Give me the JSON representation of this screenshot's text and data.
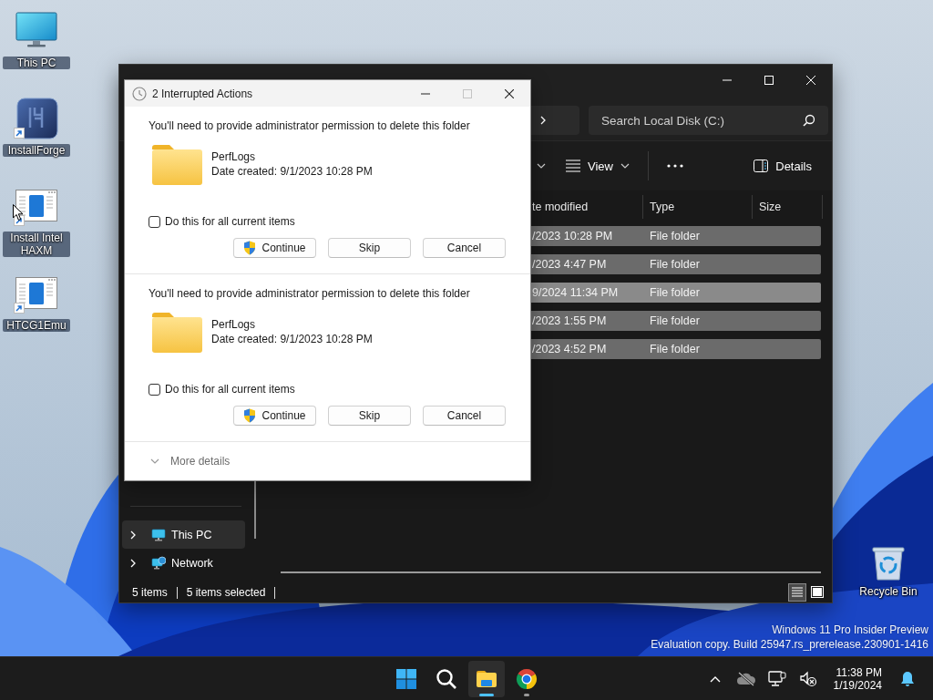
{
  "desktop_icons": [
    {
      "label": "This PC",
      "kind": "computer",
      "shortcut": false
    },
    {
      "label": "InstallForge",
      "kind": "installer",
      "shortcut": true
    },
    {
      "label": "Install Intel HAXM",
      "kind": "app-window",
      "shortcut": true
    },
    {
      "label": "HTCG1Emu",
      "kind": "app-window",
      "shortcut": true
    }
  ],
  "recycle_bin": {
    "label": "Recycle Bin"
  },
  "explorer": {
    "search": {
      "placeholder": "Search Local Disk (C:)"
    },
    "toolbar": {
      "view": "View",
      "details": "Details"
    },
    "columns": [
      "te modified",
      "Type",
      "Size"
    ],
    "rows": [
      {
        "date_modified": "/2023 10:28 PM",
        "type": "File folder",
        "selected": true,
        "hovered": false
      },
      {
        "date_modified": "/2023 4:47 PM",
        "type": "File folder",
        "selected": true,
        "hovered": false
      },
      {
        "date_modified": "9/2024 11:34 PM",
        "type": "File folder",
        "selected": true,
        "hovered": true
      },
      {
        "date_modified": "/2023 1:55 PM",
        "type": "File folder",
        "selected": true,
        "hovered": false
      },
      {
        "date_modified": "/2023 4:52 PM",
        "type": "File folder",
        "selected": true,
        "hovered": false
      }
    ],
    "sidebar": [
      {
        "label": "This PC",
        "kind": "computer",
        "selected": true
      },
      {
        "label": "Network",
        "kind": "network",
        "selected": false
      }
    ],
    "status_bar": [
      "5 items",
      "5 items selected"
    ],
    "view_modes": [
      {
        "kind": "details",
        "selected": true
      },
      {
        "kind": "tiles",
        "selected": false
      }
    ]
  },
  "dialog": {
    "title": "2 Interrupted Actions",
    "actions": [
      {
        "message": "You'll need to provide administrator permission to delete this folder",
        "item_name": "PerfLogs",
        "item_detail": "Date created: 9/1/2023 10:28 PM",
        "checkbox": {
          "label": "Do this for all current items",
          "checked": false
        },
        "buttons": [
          {
            "label": "Continue",
            "kind": "elevated"
          },
          {
            "label": "Skip",
            "kind": "plain"
          },
          {
            "label": "Cancel",
            "kind": "plain"
          }
        ]
      },
      {
        "message": "You'll need to provide administrator permission to delete this folder",
        "item_name": "PerfLogs",
        "item_detail": "Date created: 9/1/2023 10:28 PM",
        "checkbox": {
          "label": "Do this for all current items",
          "checked": false
        },
        "buttons": [
          {
            "label": "Continue",
            "kind": "elevated"
          },
          {
            "label": "Skip",
            "kind": "plain"
          },
          {
            "label": "Cancel",
            "kind": "plain"
          }
        ]
      }
    ],
    "more_details": "More details"
  },
  "evaluation_notice": [
    "Windows 11 Pro Insider Preview",
    "Evaluation copy. Build 25947.rs_prerelease.230901-1416"
  ],
  "taskbar": {
    "apps": [
      {
        "kind": "start",
        "active": false,
        "running": false
      },
      {
        "kind": "search",
        "active": false,
        "running": false
      },
      {
        "kind": "file-explorer",
        "active": true,
        "running": true
      },
      {
        "kind": "browser",
        "active": false,
        "running": true
      }
    ],
    "clock": {
      "time": "11:38 PM",
      "date": "1/19/2024"
    }
  }
}
